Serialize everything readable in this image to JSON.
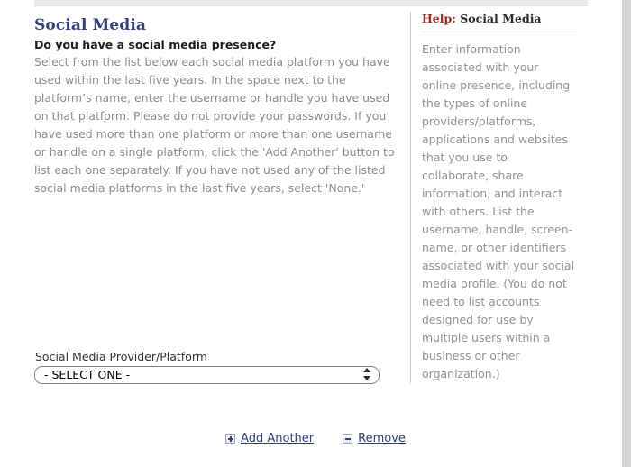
{
  "section": {
    "title": "Social Media",
    "question": "Do you have a social media presence?",
    "instructions": "Select from the list below each social media platform you have used within the last five years. In the space next to the platform’s name, enter the username or handle you have used on that platform. Please do not provide your passwords. If you have used more than one platform or more than one username or handle on a single platform, click the 'Add Another' button to list each one separately. If you have not used any of the listed social media platforms in the last five years, select 'None.'"
  },
  "help": {
    "label": "Help:",
    "topic": "Social Media",
    "body": "Enter information associated with your online presence, including the types of online providers/platforms, applications and websites that you use to collaborate, share information, and interact with others. List the username, handle, screen-name, or other identifiers associated with your social media profile. (You do not need to list accounts designed for use by multiple users within a business or other organization.)"
  },
  "form": {
    "select_label": "Social Media Provider/Platform",
    "select_value": "- SELECT ONE -",
    "select_options": [
      "- SELECT ONE -"
    ]
  },
  "actions": {
    "add": {
      "label": "Add Another",
      "icon": "plus-icon"
    },
    "remove": {
      "label": "Remove",
      "icon": "minus-icon"
    }
  },
  "colors": {
    "section_title": "#334279",
    "help_label": "#9e2a1f",
    "link": "#2e3f79",
    "body_text": "#8c8c8c"
  }
}
